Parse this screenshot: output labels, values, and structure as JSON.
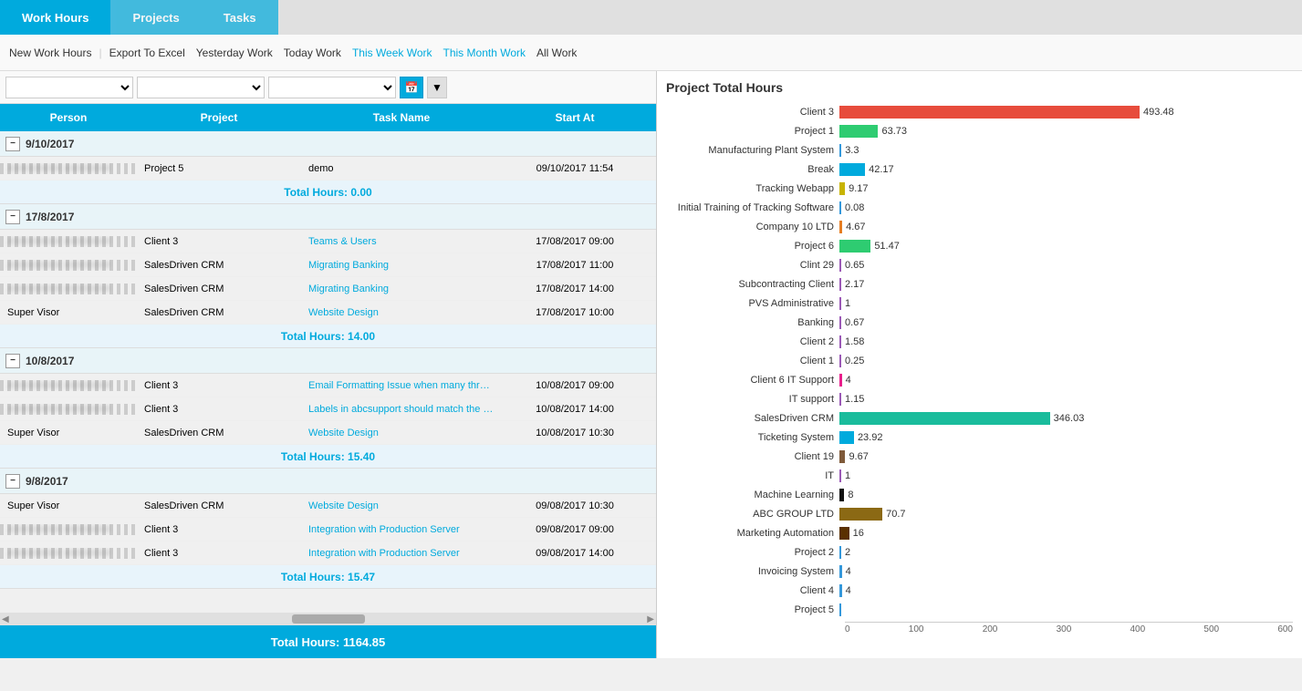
{
  "nav": {
    "tabs": [
      {
        "label": "Work Hours",
        "active": true
      },
      {
        "label": "Projects",
        "active": false
      },
      {
        "label": "Tasks",
        "active": false
      }
    ]
  },
  "toolbar": {
    "buttons": [
      {
        "label": "New Work Hours",
        "color": "normal"
      },
      {
        "label": "Export To Excel",
        "color": "normal"
      },
      {
        "label": "Yesterday Work",
        "color": "normal"
      },
      {
        "label": "Today Work",
        "color": "normal"
      },
      {
        "label": "This Week Work",
        "color": "blue"
      },
      {
        "label": "This Month Work",
        "color": "blue"
      },
      {
        "label": "All Work",
        "color": "normal"
      }
    ]
  },
  "table": {
    "columns": [
      "Person",
      "Project",
      "Task Name",
      "Start At"
    ],
    "groups": [
      {
        "date": "9/10/2017",
        "rows": [
          {
            "person": "blurred",
            "project": "Project 5",
            "task": "demo",
            "start": "09/10/2017 11:54",
            "taskColor": "normal"
          }
        ],
        "total": "0.00"
      },
      {
        "date": "17/8/2017",
        "rows": [
          {
            "person": "blurred",
            "project": "Client 3",
            "task": "Teams & Users",
            "start": "17/08/2017 09:00",
            "taskColor": "blue"
          },
          {
            "person": "blurred",
            "project": "SalesDriven CRM",
            "task": "Migrating Banking",
            "start": "17/08/2017 11:00",
            "taskColor": "blue"
          },
          {
            "person": "blurred",
            "project": "SalesDriven CRM",
            "task": "Migrating Banking",
            "start": "17/08/2017 14:00",
            "taskColor": "blue"
          },
          {
            "person": "Super Visor",
            "project": "SalesDriven CRM",
            "task": "Website Design",
            "start": "17/08/2017 10:00",
            "taskColor": "blue"
          }
        ],
        "total": "14.00"
      },
      {
        "date": "10/8/2017",
        "rows": [
          {
            "person": "blurred",
            "project": "Client 3",
            "task": "Email Formatting Issue when many threads",
            "start": "10/08/2017 09:00",
            "taskColor": "blue"
          },
          {
            "person": "blurred",
            "project": "Client 3",
            "task": "Labels in abcsupport should match the o...",
            "start": "10/08/2017 14:00",
            "taskColor": "blue"
          },
          {
            "person": "Super Visor",
            "project": "SalesDriven CRM",
            "task": "Website Design",
            "start": "10/08/2017 10:30",
            "taskColor": "blue"
          }
        ],
        "total": "15.40"
      },
      {
        "date": "9/8/2017",
        "rows": [
          {
            "person": "Super Visor",
            "project": "SalesDriven CRM",
            "task": "Website Design",
            "start": "09/08/2017 10:30",
            "taskColor": "blue"
          },
          {
            "person": "blurred",
            "project": "Client 3",
            "task": "Integration with Production Server",
            "start": "09/08/2017 09:00",
            "taskColor": "blue"
          },
          {
            "person": "blurred",
            "project": "Client 3",
            "task": "Integration with Production Server",
            "start": "09/08/2017 14:00",
            "taskColor": "blue"
          }
        ],
        "total": "15.47"
      }
    ],
    "grandTotal": "Total Hours: 1164.85"
  },
  "chart": {
    "title": "Project Total Hours",
    "maxValue": 600,
    "axisLabels": [
      "0",
      "100",
      "200",
      "300",
      "400",
      "500",
      "600"
    ],
    "bars": [
      {
        "label": "Client 3",
        "value": 493.48,
        "color": "#e74c3c"
      },
      {
        "label": "Project 1",
        "value": 63.73,
        "color": "#2ecc71"
      },
      {
        "label": "Manufacturing Plant System",
        "value": 3.3,
        "color": "#3498db"
      },
      {
        "label": "Break",
        "value": 42.17,
        "color": "#00aadd"
      },
      {
        "label": "Tracking Webapp",
        "value": 9.17,
        "color": "#c8b400"
      },
      {
        "label": "Initial Training of Tracking Software",
        "value": 0.08,
        "color": "#3498db"
      },
      {
        "label": "Company 10 LTD",
        "value": 4.67,
        "color": "#e67e22"
      },
      {
        "label": "Project 6",
        "value": 51.47,
        "color": "#2ecc71"
      },
      {
        "label": "Clint 29",
        "value": 0.65,
        "color": "#9b59b6"
      },
      {
        "label": "Subcontracting Client",
        "value": 2.17,
        "color": "#9b59b6"
      },
      {
        "label": "PVS Administrative",
        "value": 1,
        "color": "#9b59b6"
      },
      {
        "label": "Banking",
        "value": 0.67,
        "color": "#9b59b6"
      },
      {
        "label": "Client 2",
        "value": 1.58,
        "color": "#9b59b6"
      },
      {
        "label": "Client 1",
        "value": 0.25,
        "color": "#9b59b6"
      },
      {
        "label": "Client 6 IT Support",
        "value": 4,
        "color": "#e91e8c"
      },
      {
        "label": "IT support",
        "value": 1.15,
        "color": "#9b59b6"
      },
      {
        "label": "SalesDriven CRM",
        "value": 346.03,
        "color": "#1abc9c"
      },
      {
        "label": "Ticketing System",
        "value": 23.92,
        "color": "#00aadd"
      },
      {
        "label": "Client 19",
        "value": 9.67,
        "color": "#7f5a3a"
      },
      {
        "label": "IT",
        "value": 1,
        "color": "#9b59b6"
      },
      {
        "label": "Machine Learning",
        "value": 8,
        "color": "#111111"
      },
      {
        "label": "ABC GROUP LTD",
        "value": 70.7,
        "color": "#8B6914"
      },
      {
        "label": "Marketing Automation",
        "value": 16,
        "color": "#5a3000"
      },
      {
        "label": "Project 2",
        "value": 2,
        "color": "#3498db"
      },
      {
        "label": "Invoicing System",
        "value": 4,
        "color": "#3498db"
      },
      {
        "label": "Client 4",
        "value": 4,
        "color": "#3498db"
      },
      {
        "label": "Project 5",
        "value": 0,
        "color": "#3498db"
      }
    ]
  }
}
